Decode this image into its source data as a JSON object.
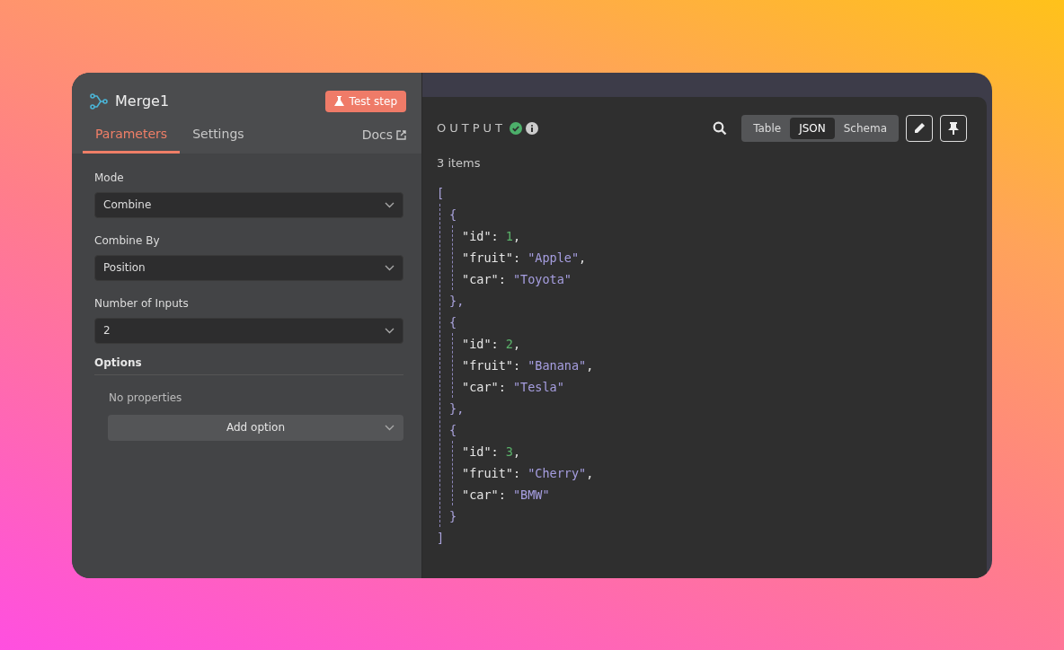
{
  "node": {
    "title": "Merge1",
    "test_button": "Test step"
  },
  "tabs": [
    {
      "label": "Parameters",
      "selected": true
    },
    {
      "label": "Settings",
      "selected": false
    }
  ],
  "docs_link": "Docs",
  "parameters": [
    {
      "label": "Mode",
      "value": "Combine"
    },
    {
      "label": "Combine By",
      "value": "Position"
    },
    {
      "label": "Number of Inputs",
      "value": "2"
    }
  ],
  "options": {
    "title": "Options",
    "empty_text": "No properties",
    "add_button": "Add option"
  },
  "output": {
    "title": "OUTPUT",
    "success": true,
    "item_count": "3 items",
    "views": [
      {
        "label": "Table",
        "selected": false
      },
      {
        "label": "JSON",
        "selected": true
      },
      {
        "label": "Schema",
        "selected": false
      }
    ]
  },
  "json_view": {
    "open": "[",
    "close": "]",
    "objects": [
      {
        "open": "{",
        "close": "},",
        "fields": [
          {
            "key": "\"id\"",
            "colon": ":",
            "value": "1",
            "kind": "number",
            "comma": ","
          },
          {
            "key": "\"fruit\"",
            "colon": ":",
            "value": "\"Apple\"",
            "kind": "string",
            "comma": ","
          },
          {
            "key": "\"car\"",
            "colon": ":",
            "value": "\"Toyota\"",
            "kind": "string"
          }
        ]
      },
      {
        "open": "{",
        "close": "},",
        "fields": [
          {
            "key": "\"id\"",
            "colon": ":",
            "value": "2",
            "kind": "number",
            "comma": ","
          },
          {
            "key": "\"fruit\"",
            "colon": ":",
            "value": "\"Banana\"",
            "kind": "string",
            "comma": ","
          },
          {
            "key": "\"car\"",
            "colon": ":",
            "value": "\"Tesla\"",
            "kind": "string"
          }
        ]
      },
      {
        "open": "{",
        "close": "}",
        "fields": [
          {
            "key": "\"id\"",
            "colon": ":",
            "value": "3",
            "kind": "number",
            "comma": ","
          },
          {
            "key": "\"fruit\"",
            "colon": ":",
            "value": "\"Cherry\"",
            "kind": "string",
            "comma": ","
          },
          {
            "key": "\"car\"",
            "colon": ":",
            "value": "\"BMW\"",
            "kind": "string"
          }
        ]
      }
    ]
  }
}
